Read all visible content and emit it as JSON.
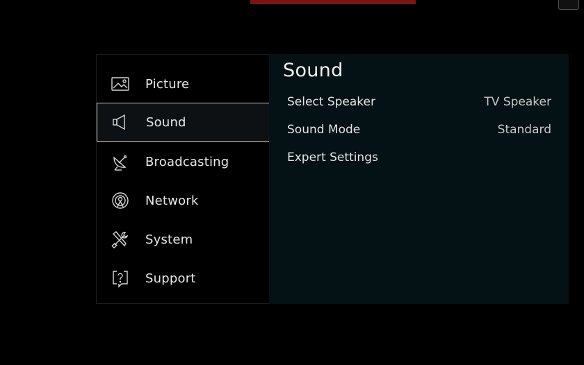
{
  "menu": {
    "sidebar": {
      "items": [
        {
          "label": "Picture",
          "icon": "picture-icon",
          "selected": false
        },
        {
          "label": "Sound",
          "icon": "speaker-icon",
          "selected": true
        },
        {
          "label": "Broadcasting",
          "icon": "satellite-dish-icon",
          "selected": false
        },
        {
          "label": "Network",
          "icon": "network-icon",
          "selected": false
        },
        {
          "label": "System",
          "icon": "tools-icon",
          "selected": false
        },
        {
          "label": "Support",
          "icon": "help-icon",
          "selected": false
        }
      ]
    },
    "panel": {
      "title": "Sound",
      "settings": [
        {
          "label": "Select Speaker",
          "value": "TV Speaker"
        },
        {
          "label": "Sound Mode",
          "value": "Standard"
        },
        {
          "label": "Expert Settings",
          "value": ""
        }
      ]
    }
  },
  "colors": {
    "background": "#000000",
    "panel_background": "#041115",
    "selection_border": "#cfcfcf",
    "banner": "#7a1414"
  }
}
